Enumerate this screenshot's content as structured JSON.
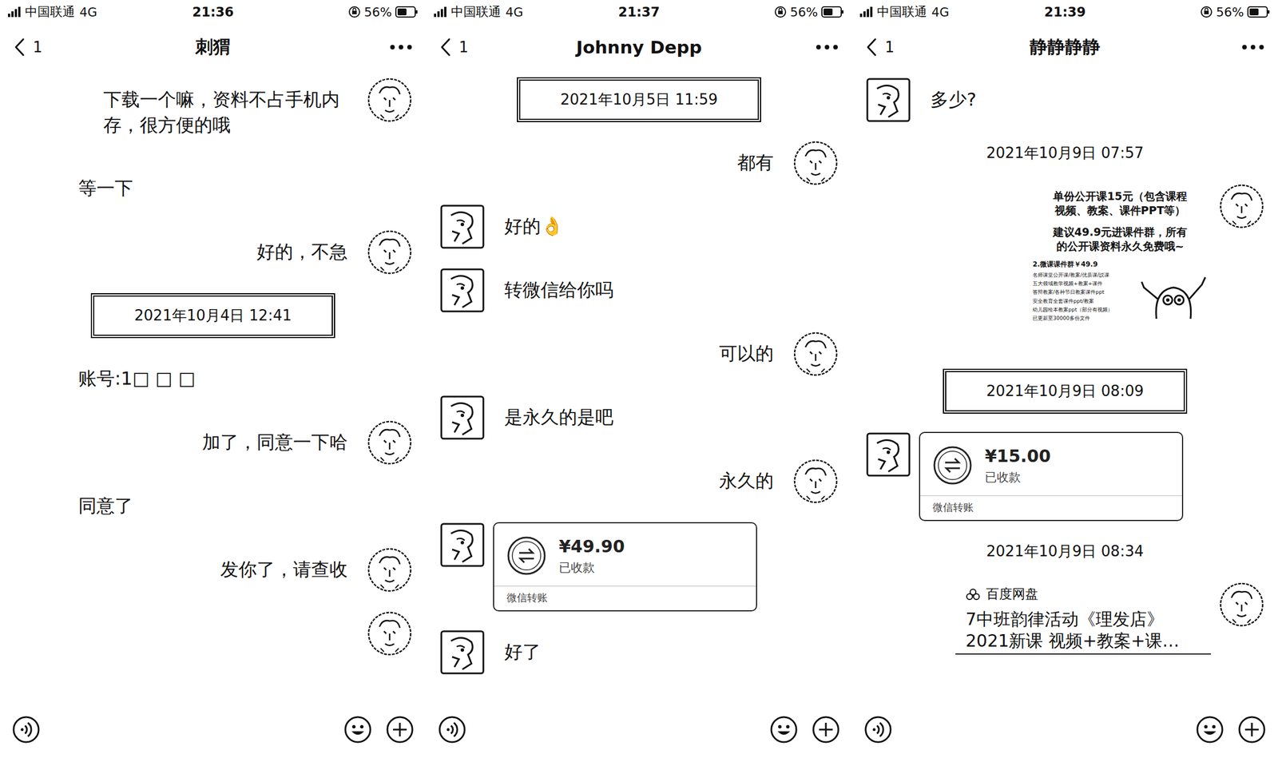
{
  "panels": [
    {
      "status": {
        "carrier": "中国联通",
        "network": "4G",
        "time": "21:36",
        "battery": "56%",
        "battery_level": 0.56
      },
      "header": {
        "back_count": "1",
        "title": "刺猬"
      },
      "messages": [
        {
          "kind": "text",
          "side": "right",
          "avatar_shown": true,
          "text": "下载一个嘛，资料不占手机内存，很方便的哦"
        },
        {
          "kind": "text",
          "side": "left",
          "avatar_shown": false,
          "text": "等一下"
        },
        {
          "kind": "text",
          "side": "right",
          "avatar_shown": true,
          "text": "好的，不急"
        },
        {
          "kind": "time",
          "boxed": true,
          "text": "2021年10月4日 12:41"
        },
        {
          "kind": "text",
          "side": "left",
          "avatar_shown": false,
          "text": "账号:1□ □ □"
        },
        {
          "kind": "text",
          "side": "right",
          "avatar_shown": true,
          "text": "加了，同意一下哈"
        },
        {
          "kind": "text",
          "side": "left",
          "avatar_shown": false,
          "text": "同意了"
        },
        {
          "kind": "text",
          "side": "right",
          "avatar_shown": true,
          "text": "发你了，请查收"
        },
        {
          "kind": "blank",
          "side": "right",
          "avatar_shown": true
        }
      ]
    },
    {
      "status": {
        "carrier": "中国联通",
        "network": "4G",
        "time": "21:37",
        "battery": "56%",
        "battery_level": 0.56
      },
      "header": {
        "back_count": "1",
        "title": "Johnny Depp"
      },
      "messages": [
        {
          "kind": "time",
          "boxed": true,
          "text": "2021年10月5日 11:59"
        },
        {
          "kind": "text",
          "side": "right",
          "avatar_shown": true,
          "text": "都有"
        },
        {
          "kind": "text",
          "side": "left",
          "avatar_shown": true,
          "text": "好的👌"
        },
        {
          "kind": "text",
          "side": "left",
          "avatar_shown": true,
          "text": "转微信给你吗"
        },
        {
          "kind": "text",
          "side": "right",
          "avatar_shown": true,
          "text": "可以的"
        },
        {
          "kind": "text",
          "side": "left",
          "avatar_shown": true,
          "text": "是永久的是吧"
        },
        {
          "kind": "text",
          "side": "right",
          "avatar_shown": true,
          "text": "永久的"
        },
        {
          "kind": "transfer",
          "side": "left",
          "avatar_shown": true,
          "amount": "¥49.90",
          "status": "已收款",
          "label": "微信转账"
        },
        {
          "kind": "text",
          "side": "left",
          "avatar_shown": true,
          "text": "好了"
        }
      ]
    },
    {
      "status": {
        "carrier": "中国联通",
        "network": "4G",
        "time": "21:39",
        "battery": "56%",
        "battery_level": 0.56
      },
      "header": {
        "back_count": "1",
        "title": "静静静静"
      },
      "messages": [
        {
          "kind": "text",
          "side": "left",
          "avatar_shown": true,
          "text": "多少?"
        },
        {
          "kind": "time",
          "boxed": false,
          "text": "2021年10月9日 07:57"
        },
        {
          "kind": "image",
          "side": "right",
          "avatar_shown": true,
          "headline_lines": [
            "单份公开课15元（包含课程",
            "视频、教案、课件PPT等）"
          ],
          "offer_lines": [
            "建议49.9元进课件群，所有",
            "的公开课资料永久免费哦~"
          ],
          "list_title": "2.微课课件群￥49.9",
          "list": [
            "名师课堂公开课/教案/优质课/説课",
            "五大领域教学视频+教案+课件",
            "答辩教案/各种节日教案课件ppt",
            "安全教育全套课件ppt/教案",
            "幼儿园绘本教案ppt（部分有视频）"
          ],
          "footer": "已更新至30000多份文件"
        },
        {
          "kind": "time",
          "boxed": true,
          "text": "2021年10月9日 08:09"
        },
        {
          "kind": "transfer",
          "side": "left",
          "avatar_shown": true,
          "amount": "¥15.00",
          "status": "已收款",
          "label": "微信转账"
        },
        {
          "kind": "time",
          "boxed": false,
          "text": "2021年10月9日 08:34"
        },
        {
          "kind": "link",
          "side": "right",
          "avatar_shown": true,
          "source": "百度网盘",
          "title_lines": [
            "7中班韵律活动《理发店》",
            "2021新课 视频+教案+课…"
          ]
        }
      ]
    }
  ]
}
